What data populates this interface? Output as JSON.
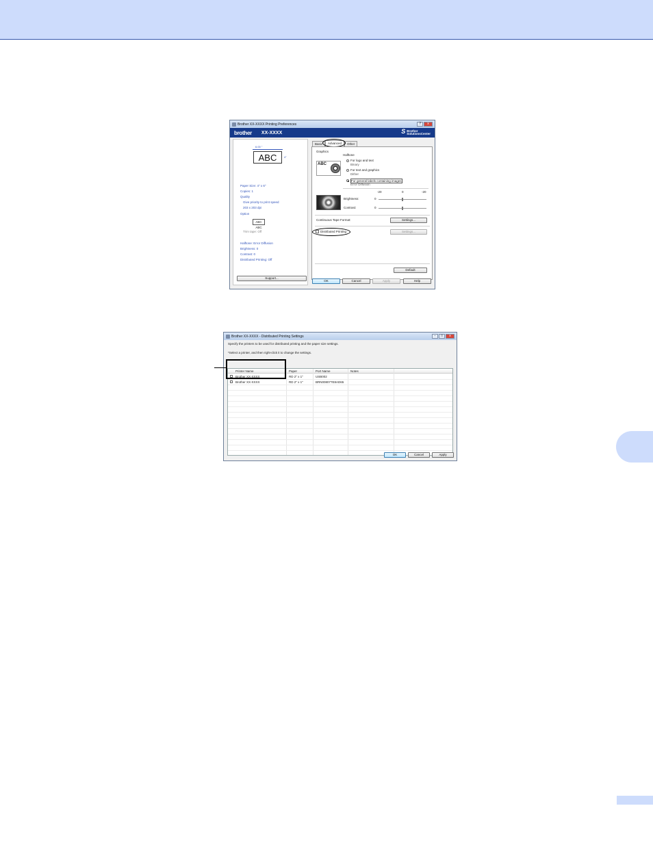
{
  "window1": {
    "title": "Brother XX-XXXX Printing Preferences",
    "brand": "brother",
    "model": "XX-XXXX",
    "solutions_center": [
      "Brother",
      "SolutionsCenter"
    ],
    "preview": {
      "width_label": "6.00 \"",
      "height_label": "4\"",
      "sample_text": "ABC",
      "small_sample_text": "ABC ABC"
    },
    "info": {
      "paper_size": "Paper Size: 4\" x 6\"",
      "copies": "Copies: 1",
      "quality": "Quality",
      "quality_value": "Give priority to print speed",
      "resolution": "203 x 203 dpi",
      "option": "Option",
      "trim_tape": "Trim tape: Off",
      "halftone": "Halftone: Error Diffusion",
      "brightness": "Brightness:   0",
      "contrast": "Contrast:   0",
      "distributed": "Distributed Printing: Off"
    },
    "tabs": [
      "Basic",
      "Advanced",
      "Other"
    ],
    "panel": {
      "graphics_label": "Graphics",
      "halftone_label": "Halftone",
      "radio1": "For logo and text",
      "radio1_sub": "Binary",
      "radio2": "For text and graphics",
      "radio2_sub": "Dither",
      "radio3": "For general labels containing images",
      "radio3_sub": "Error Diffusion",
      "abc": "ABC",
      "scale": [
        "-20",
        "0",
        "-20"
      ],
      "brightness": "Brightness:",
      "brightness_val": "0",
      "contrast": "Contrast:",
      "contrast_val": "0",
      "continuous_tape": "Continuous Tape Format:",
      "settings": "Settings...",
      "distributed": "Distributed Printing",
      "settings2": "Settings...",
      "default": "Default"
    },
    "buttons": {
      "support": "Support...",
      "ok": "OK",
      "cancel": "Cancel",
      "apply": "Apply",
      "help": "Help"
    }
  },
  "window2": {
    "title": "Brother XX-XXXX - Distributed Printing Settings",
    "instruction1": "Specify the printers to be used for distributed printing and the paper size settings.",
    "instruction2": "*Select a printer, and then right-click it to change the settings.",
    "columns": [
      "Printer Name",
      "Paper",
      "Port Name",
      "Notes"
    ],
    "rows": [
      {
        "printer": "Brother XX-XXXX",
        "paper": "RD 2\" x 1\"",
        "port": "USB002",
        "notes": ""
      },
      {
        "printer": "Brother XX-XXXX",
        "paper": "RD 2\" x 1\"",
        "port": "BRN008077E8AD65",
        "notes": ""
      }
    ],
    "buttons": {
      "ok": "OK",
      "cancel": "Cancel",
      "apply": "Apply"
    }
  },
  "colors": {
    "band": "#cddcfc",
    "brand_bar": "#163a8a",
    "info_text": "#3355bb"
  }
}
